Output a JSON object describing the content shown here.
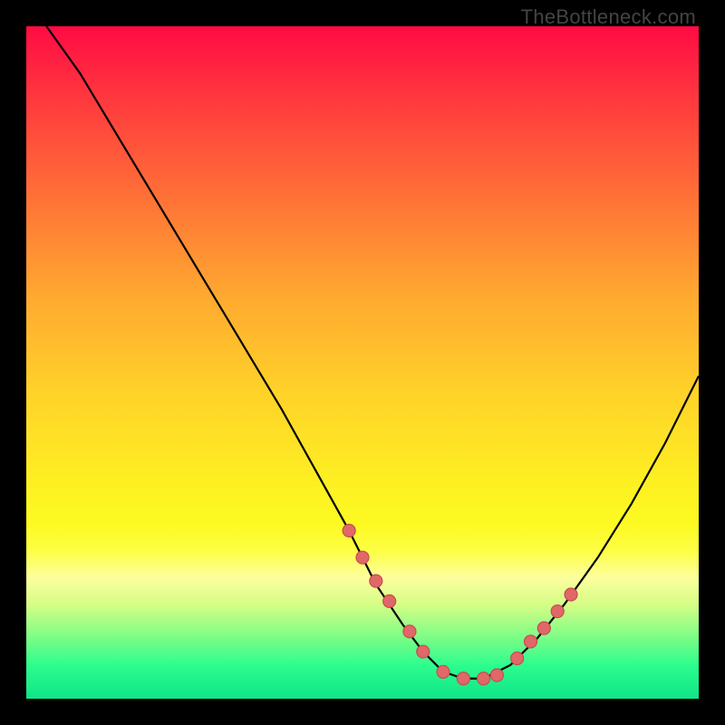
{
  "watermark": "TheBottleneck.com",
  "chart_data": {
    "type": "line",
    "title": "",
    "xlabel": "",
    "ylabel": "",
    "xlim": [
      0,
      100
    ],
    "ylim": [
      0,
      100
    ],
    "curve": {
      "x": [
        3,
        8,
        14,
        20,
        26,
        32,
        38,
        43,
        48,
        52,
        56,
        59,
        62,
        65,
        68,
        72,
        76,
        80,
        85,
        90,
        95,
        100
      ],
      "y": [
        100,
        93,
        83,
        73,
        63,
        53,
        43,
        34,
        25,
        17,
        11,
        7,
        4,
        3,
        3,
        5,
        9,
        14,
        21,
        29,
        38,
        48
      ]
    },
    "markers": {
      "x": [
        48,
        50,
        52,
        54,
        57,
        59,
        62,
        65,
        68,
        70,
        73,
        75,
        77,
        79,
        81
      ],
      "y": [
        25,
        21,
        17.5,
        14.5,
        10,
        7,
        4,
        3,
        3,
        3.5,
        6,
        8.5,
        10.5,
        13,
        15.5
      ]
    },
    "marker_style": {
      "color": "#e06868",
      "stroke": "#c74d4d",
      "radius": 7
    },
    "line_style": {
      "color": "#000000",
      "width": 2.2
    }
  }
}
